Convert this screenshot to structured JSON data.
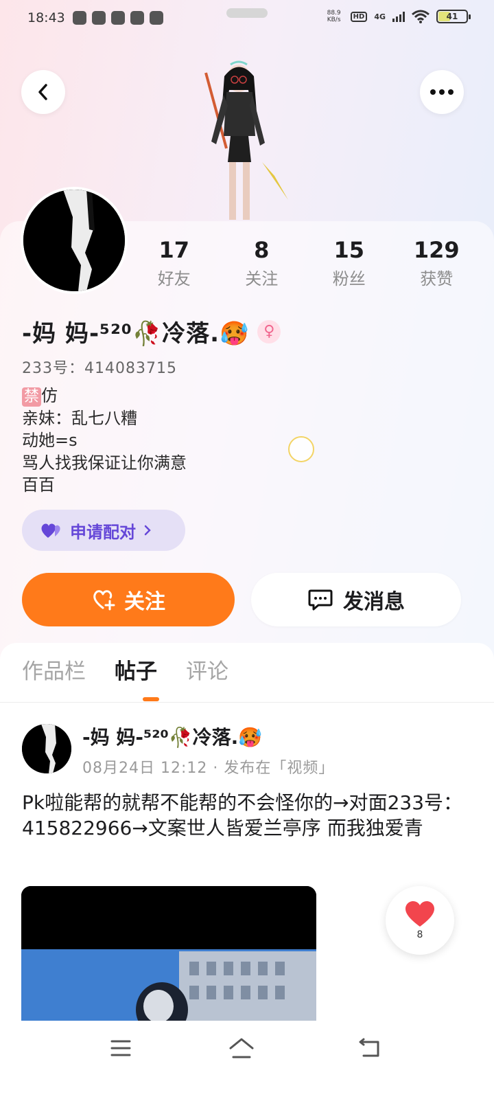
{
  "status_bar": {
    "time": "18:43",
    "net_speed_value": "88.9",
    "net_speed_unit": "KB/s",
    "hd": "HD",
    "network": "4G",
    "battery": "41"
  },
  "profile": {
    "stats": [
      {
        "value": "17",
        "label": "好友"
      },
      {
        "value": "8",
        "label": "关注"
      },
      {
        "value": "15",
        "label": "粉丝"
      },
      {
        "value": "129",
        "label": "获赞"
      }
    ],
    "name": "-妈 妈-⁵²⁰🥀冷落.🥵",
    "gender_symbol": "♀",
    "uid": "233号：414083715",
    "bio_tag": "禁",
    "bio_lines": [
      "仿",
      "亲妹：乱七八糟",
      "动她=s",
      "骂人找我保证让你满意",
      "百百"
    ],
    "match_label": "申请配对",
    "follow_label": "关注",
    "message_label": "发消息"
  },
  "tabs": [
    "作品栏",
    "帖子",
    "评论"
  ],
  "active_tab": "帖子",
  "post": {
    "author": "-妈 妈-⁵²⁰🥀冷落.🥵",
    "meta": "08月24日 12:12 · 发布在「视频」",
    "text": "Pk啦能帮的就帮不能帮的不会怪你的→对面233号：415822966→文案世人皆爱兰亭序 而我独爱青",
    "likes": "8"
  },
  "colors": {
    "accent": "#ff7a1a",
    "match_bg": "#e5e0f6",
    "match_text": "#6547d8",
    "like_red": "#f2454d"
  },
  "icons": [
    "back-icon",
    "more-icon",
    "heart-plus-icon",
    "chat-icon",
    "pair-heart-icon",
    "chevron-right-icon",
    "female-icon",
    "heart-icon",
    "menu-icon",
    "home-icon",
    "back-nav-icon"
  ]
}
